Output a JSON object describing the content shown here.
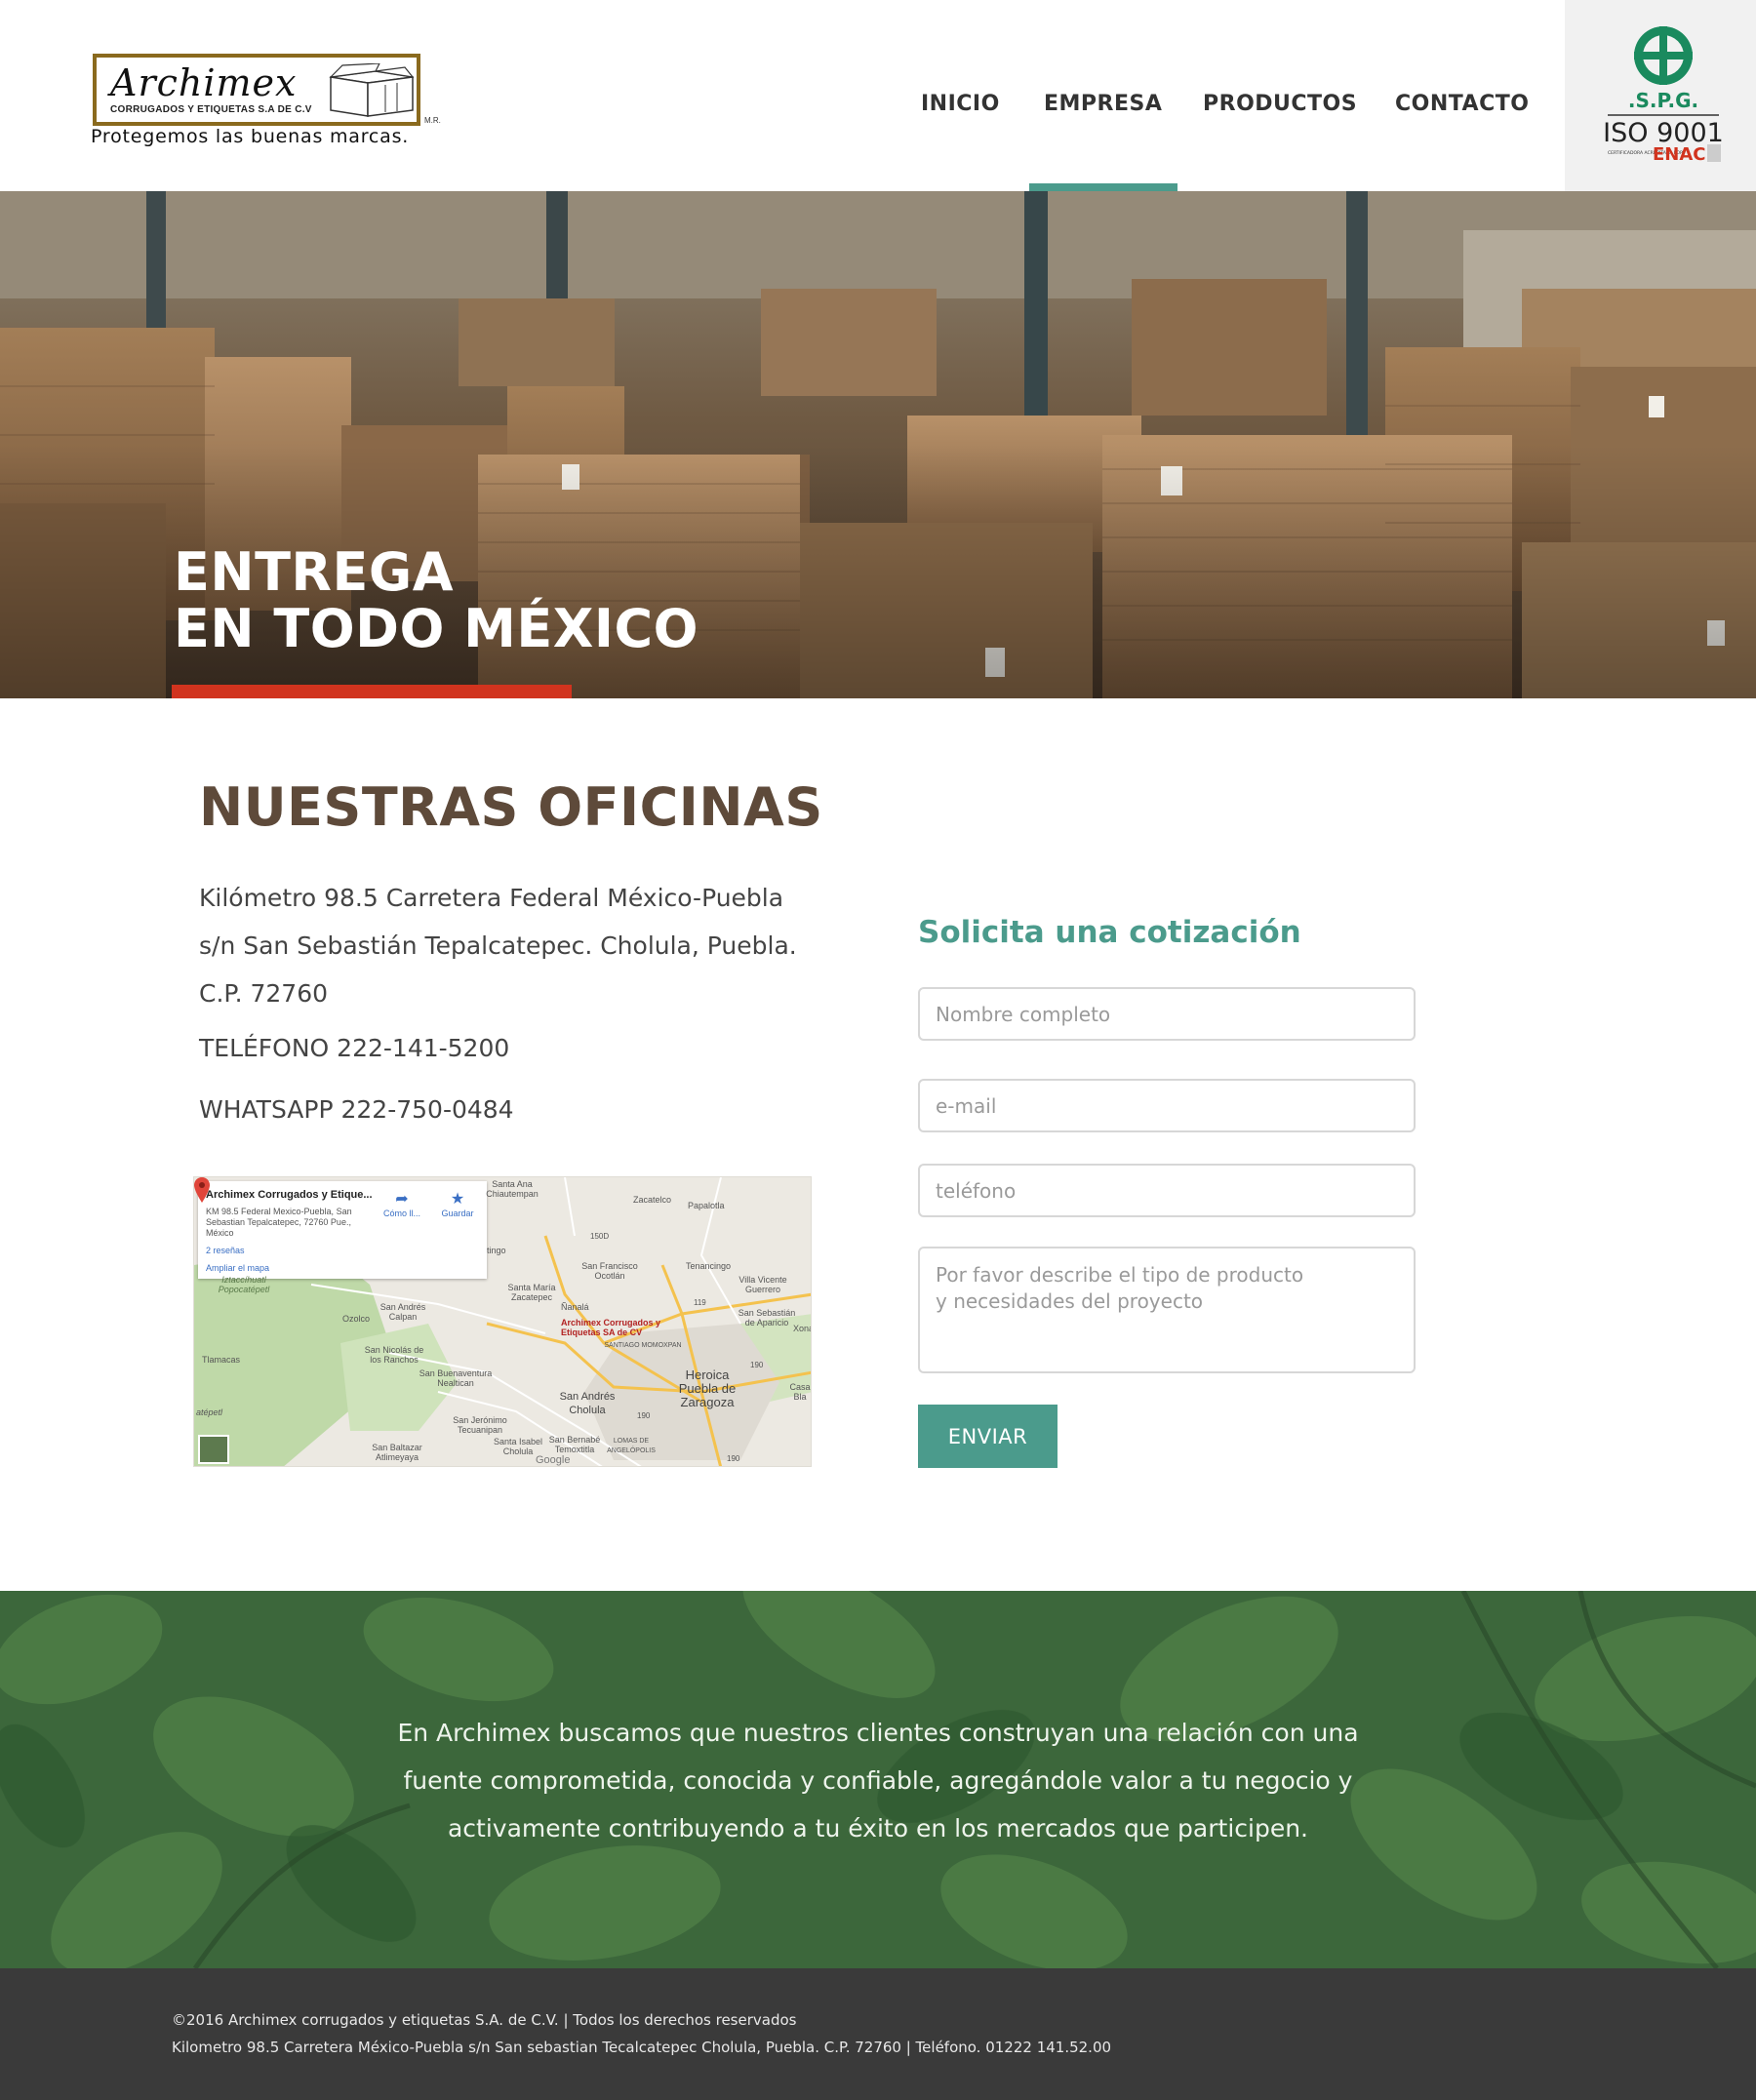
{
  "brand": {
    "name": "Archimex",
    "subtitle": "CORRUGADOS Y ETIQUETAS S.A DE C.V",
    "tagline": "Protegemos las buenas marcas.",
    "mark": "M.R.",
    "brown": "#8a6a1e"
  },
  "nav": {
    "items": [
      {
        "label": "INICIO",
        "active": false
      },
      {
        "label": "EMPRESA",
        "active": true
      },
      {
        "label": "PRODUCTOS",
        "active": false
      },
      {
        "label": "CONTACTO",
        "active": false
      }
    ],
    "active_color": "#4b9b8c"
  },
  "certification": {
    "org": ".S.P.G.",
    "standard": "ISO 9001",
    "accredited_small": "CERTIFICADORA ACREDITADA POR",
    "accreditor": "ENAC"
  },
  "hero": {
    "title_line1": "ENTREGA",
    "title_line2": "EN TODO MÉXICO",
    "accent_color": "#d1331e"
  },
  "offices": {
    "title": "NUESTRAS OFICINAS",
    "address_lines": [
      "Kilómetro 98.5 Carretera Federal México-Puebla",
      "s/n San Sebastián Tepalcatepec. Cholula, Puebla.",
      "C.P. 72760"
    ],
    "phone": "TELÉFONO 222-141-5200",
    "whatsapp": "WHATSAPP 222-750-0484"
  },
  "map": {
    "card_title": "Archimex Corrugados y Etique...",
    "card_address": "KM 98.5 Federal Mexico-Puebla, San Sebastian Tepalcatepec, 72760 Pue., México",
    "reviews": "2 reseñas",
    "expand": "Ampliar el mapa",
    "directions": "Cómo ll...",
    "save": "Guardar",
    "pin_label": "Archimex Corrugados y Etiquetas SA de CV",
    "google": "Google",
    "places": {
      "santa_ana": "Santa Ana Chiautempan",
      "zacatelco": "Zacatelco",
      "papalotla": "Papalotla",
      "tenancingo": "Tenancingo",
      "san_francisco": "San Francisco Ocotlán",
      "villa_vicente": "Villa Vicente Guerrero",
      "santa_maria": "Santa María Zacatepec",
      "nanala": "Ñanalá",
      "san_andres_calpan": "San Andrés Calpan",
      "ozolco": "Ozolco",
      "iztaccihuatl": "Iztaccíhuatl Popocatépetl",
      "san_nicolas": "San Nicolás de los Ranchos",
      "tlamacas": "Tlamacas",
      "san_buenaventura": "San Buenaventura Nealtican",
      "san_sebastian": "San Sebastián de Aparicio",
      "santiago": "SANTIAGO MOMOXPAN",
      "heroica": "Heroica Puebla de Zaragoza",
      "san_andres_cholula": "San Andrés Cholula",
      "san_jeronimo": "San Jerónimo Tecuanipan",
      "santa_isabel": "Santa Isabel Cholula",
      "san_bernabe": "San Bernabé Temoxtitla",
      "lomas": "LOMAS DE ANGELÓPOLIS",
      "san_baltazar": "San Baltazar Atlimeyaya",
      "casa_bla": "Casa Bla",
      "xonaca": "Xona",
      "atepetl": "atépetl",
      "tingo": "tingo",
      "r150": "150D",
      "r119": "119",
      "r190": "190",
      "r190b": "190",
      "r190c": "190"
    }
  },
  "form": {
    "title": "Solicita una cotización",
    "name_placeholder": "Nombre completo",
    "email_placeholder": "e-mail",
    "phone_placeholder": "teléfono",
    "message_placeholder": "Por favor describe el tipo de producto\ny necesidades del proyecto",
    "submit_label": "ENVIAR",
    "accent": "#4b9b8c"
  },
  "mission": {
    "line1": "En Archimex buscamos que nuestros clientes construyan una relación con una",
    "line2": "fuente comprometida, conocida y confiable, agregándole valor a tu negocio y",
    "line3": "activamente contribuyendo a tu éxito en los mercados que participen."
  },
  "footer": {
    "line1": "©2016 Archimex corrugados y etiquetas S.A. de C.V. |  Todos los derechos reservados",
    "line2": "Kilometro 98.5 Carretera México-Puebla s/n San sebastian Tecalcatepec Cholula, Puebla. C.P. 72760   |  Teléfono. 01222 141.52.00"
  }
}
